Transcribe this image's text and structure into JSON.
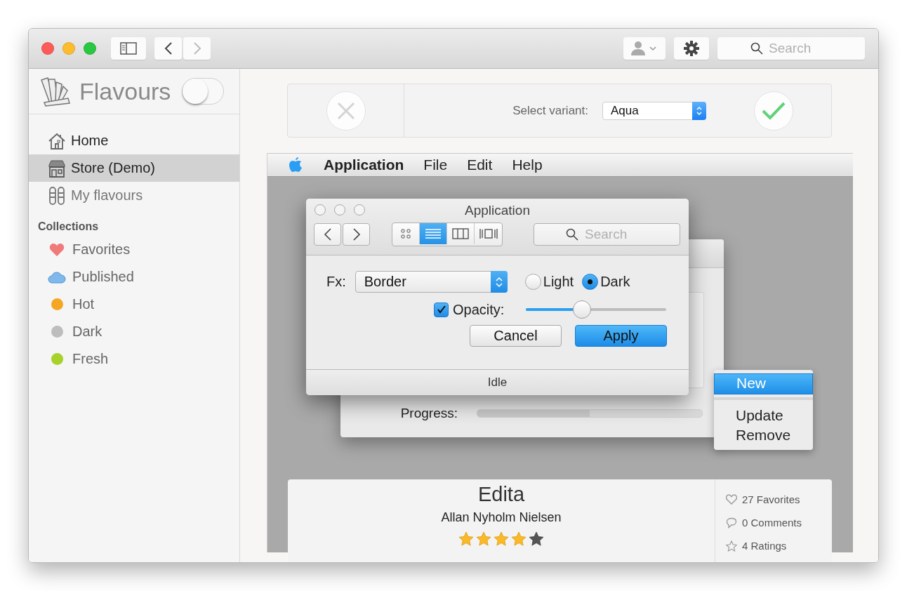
{
  "titlebar": {
    "search": {
      "placeholder": "Search"
    }
  },
  "sidebar": {
    "app_name": "Flavours",
    "app_toggle": {
      "on": false
    },
    "items": [
      {
        "label": "Home",
        "kind": "home",
        "selected": false,
        "disabled": false
      },
      {
        "label": "Store (Demo)",
        "kind": "store",
        "selected": true,
        "disabled": false
      },
      {
        "label": "My flavours",
        "kind": "flavours",
        "selected": false,
        "disabled": true
      }
    ],
    "collections_heading": "Collections",
    "collections": [
      {
        "label": "Favorites",
        "kind": "heart"
      },
      {
        "label": "Published",
        "kind": "cloud"
      },
      {
        "label": "Hot",
        "kind": "dot",
        "color": "#f5a623"
      },
      {
        "label": "Dark",
        "kind": "dot",
        "color": "#bdbdbd"
      },
      {
        "label": "Fresh",
        "kind": "dot",
        "color": "#a6d22a"
      }
    ]
  },
  "variant_bar": {
    "label": "Select variant:",
    "value": "Aqua"
  },
  "preview": {
    "app_menu": "Application",
    "menus": [
      "File",
      "Edit",
      "Help"
    ],
    "back_window": {
      "progress_label": "Progress:",
      "level": 0.5
    },
    "dialog": {
      "title": "Application",
      "view_modes": [
        {
          "kind": "grid",
          "selected": false
        },
        {
          "kind": "list",
          "selected": true
        },
        {
          "kind": "columns",
          "selected": false
        },
        {
          "kind": "coverflow",
          "selected": false
        }
      ],
      "search": {
        "placeholder": "Search"
      },
      "fx_label": "Fx:",
      "fx_value": "Border",
      "themes": [
        {
          "label": "Light",
          "selected": false
        },
        {
          "label": "Dark",
          "selected": true
        }
      ],
      "opacity": {
        "label": "Opacity:",
        "checked": true,
        "level": 0.4
      },
      "buttons": [
        {
          "label": "Cancel",
          "default": false
        },
        {
          "label": "Apply",
          "default": true
        }
      ],
      "status": "Idle"
    },
    "context_menu": {
      "groups": [
        [
          {
            "label": "New",
            "selected": true
          }
        ],
        [
          {
            "label": "Update",
            "selected": false
          },
          {
            "label": "Remove",
            "selected": false
          }
        ]
      ]
    },
    "card": {
      "title": "Edita",
      "author": "Allan Nyholm Nielsen",
      "stars": 4,
      "stats": [
        {
          "kind": "heart",
          "text": "27 Favorites"
        },
        {
          "kind": "comment",
          "text": "0 Comments"
        },
        {
          "kind": "star",
          "text": "4 Ratings"
        }
      ]
    }
  }
}
